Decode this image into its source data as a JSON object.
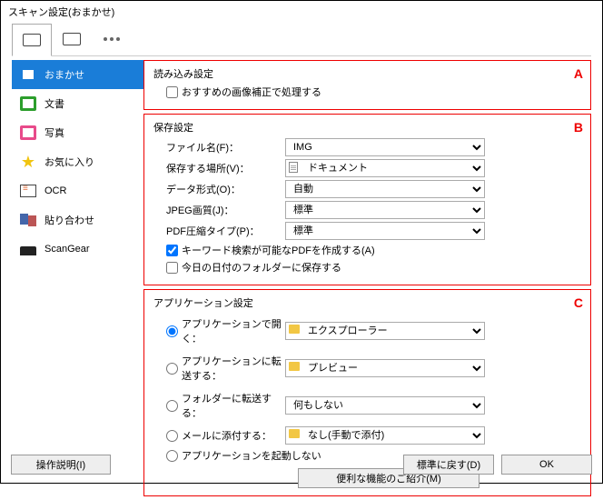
{
  "window": {
    "title": "スキャン設定(おまかせ)"
  },
  "sidebar": {
    "items": [
      {
        "label": "おまかせ"
      },
      {
        "label": "文書"
      },
      {
        "label": "写真"
      },
      {
        "label": "お気に入り"
      },
      {
        "label": "OCR"
      },
      {
        "label": "貼り合わせ"
      },
      {
        "label": "ScanGear"
      }
    ]
  },
  "groupA": {
    "marker": "A",
    "title": "読み込み設定",
    "recommended_correction": "おすすめの画像補正で処理する"
  },
  "groupB": {
    "marker": "B",
    "title": "保存設定",
    "filename_label": "ファイル名(F)：",
    "filename_value": "IMG",
    "saveto_label": "保存する場所(V)：",
    "saveto_value": "ドキュメント",
    "format_label": "データ形式(O)：",
    "format_value": "自動",
    "jpeg_label": "JPEG画質(J)：",
    "jpeg_value": "標準",
    "pdf_label": "PDF圧縮タイプ(P)：",
    "pdf_value": "標準",
    "keyword_pdf": "キーワード検索が可能なPDFを作成する(A)",
    "date_folder": "今日の日付のフォルダーに保存する"
  },
  "groupC": {
    "marker": "C",
    "title": "アプリケーション設定",
    "open_with": "アプリケーションで開く：",
    "open_with_value": "エクスプローラー",
    "send_app": "アプリケーションに転送する：",
    "send_app_value": "プレビュー",
    "send_folder": "フォルダーに転送する：",
    "send_folder_value": "何もしない",
    "mail": "メールに添付する：",
    "mail_value": "なし(手動で添付)",
    "no_launch": "アプリケーションを起動しない",
    "intro_btn": "便利な機能のご紹介(M)"
  },
  "footer": {
    "desc": "操作説明(I)",
    "reset": "標準に戻す(D)",
    "ok": "OK"
  }
}
